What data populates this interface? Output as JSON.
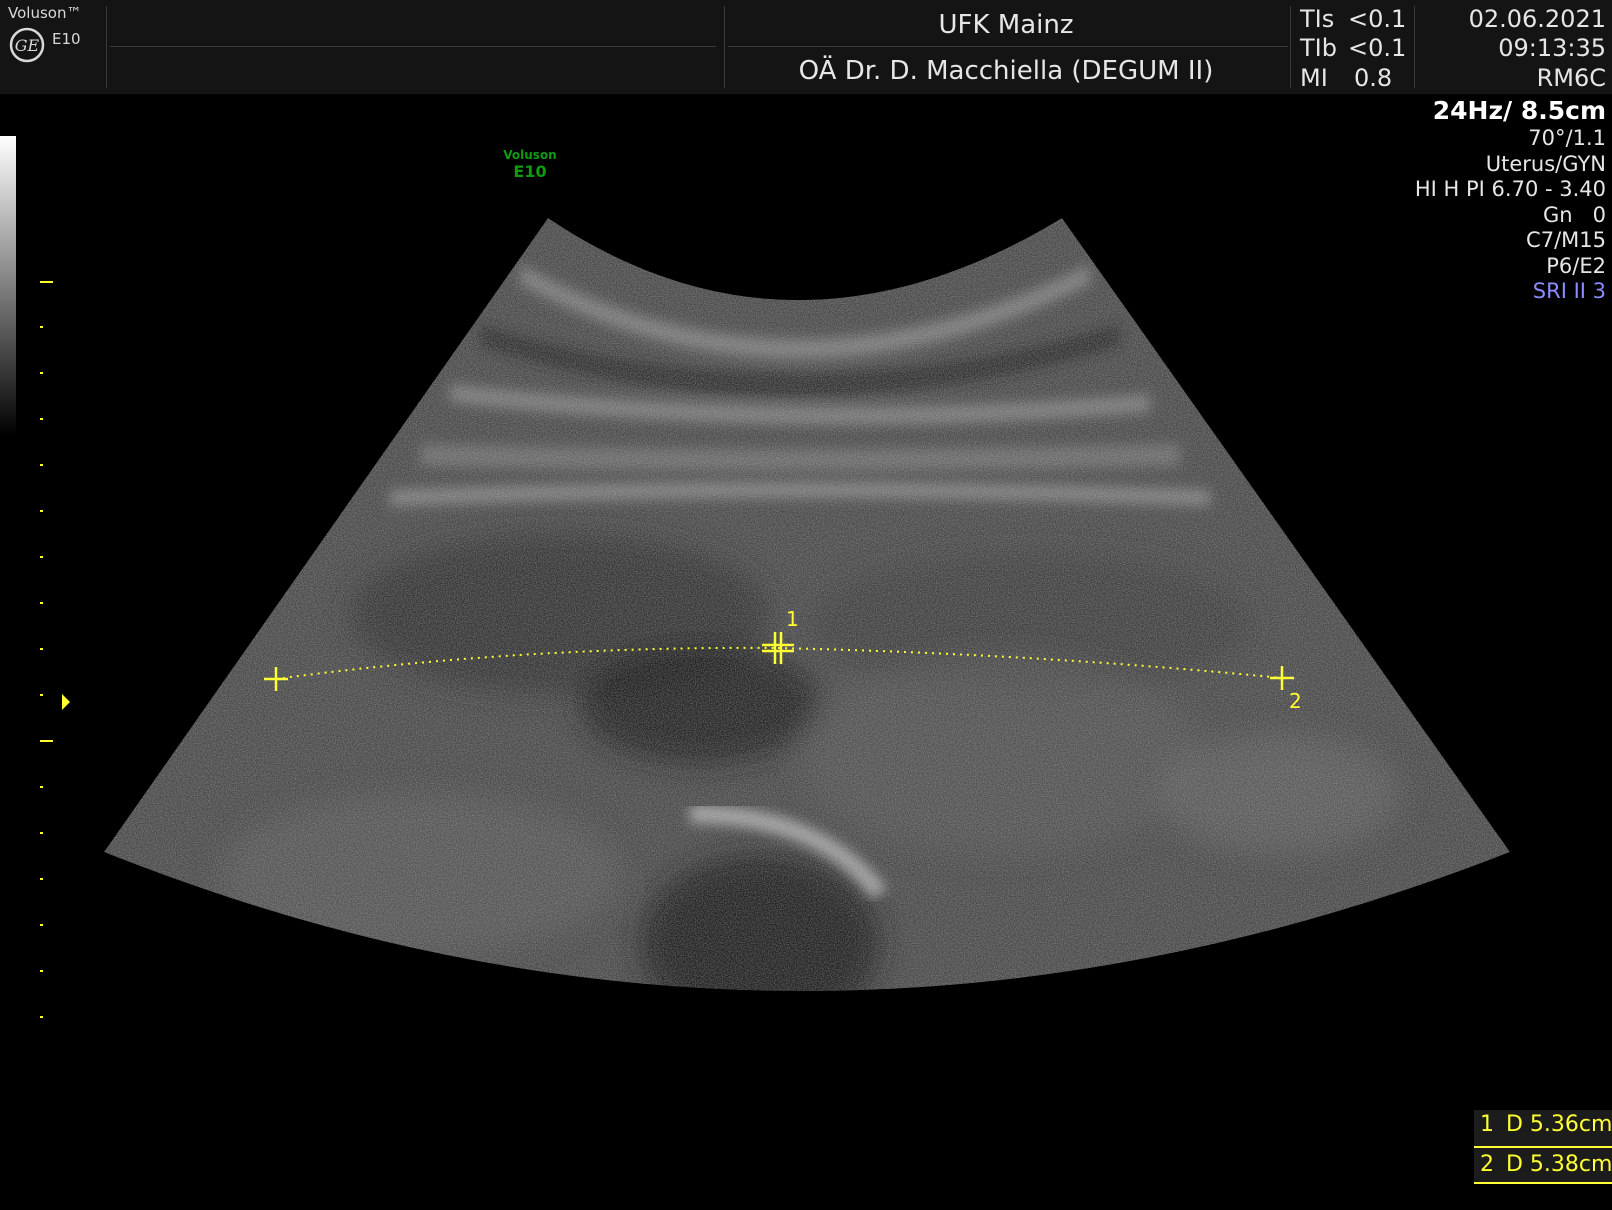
{
  "header": {
    "brand": "Voluson™",
    "model": "E10",
    "logo_icon": "ge-logo-icon",
    "institution": "UFK Mainz",
    "operator": "OÄ Dr. D. Macchiella (DEGUM II)",
    "indices": [
      {
        "label": "TIs",
        "value": "<0.1"
      },
      {
        "label": "TIb",
        "value": "<0.1"
      },
      {
        "label": "MI",
        "value": "0.8"
      }
    ],
    "date": "02.06.2021",
    "time": "09:13:35",
    "probe": "RM6C"
  },
  "image_logo": {
    "line1": "Voluson",
    "line2": "E10"
  },
  "params": {
    "frame_depth": "24Hz/ 8.5cm",
    "angle": "70°/1.1",
    "preset": "Uterus/GYN",
    "harmonic": "HI H PI 6.70 - 3.40",
    "gain": "Gn   0",
    "contrast": "C7/M15",
    "power": "P6/E2",
    "sri": "SRI II 3"
  },
  "markers": {
    "m1": "1",
    "m2": "2"
  },
  "measurements": [
    {
      "index": "1",
      "text": "D 5.36cm"
    },
    {
      "index": "2",
      "text": "D 5.38cm"
    }
  ],
  "colors": {
    "measurement": "#ffff33",
    "logo_green": "#0f9b0f",
    "sri": "#8a8cff",
    "background": "#000000"
  }
}
